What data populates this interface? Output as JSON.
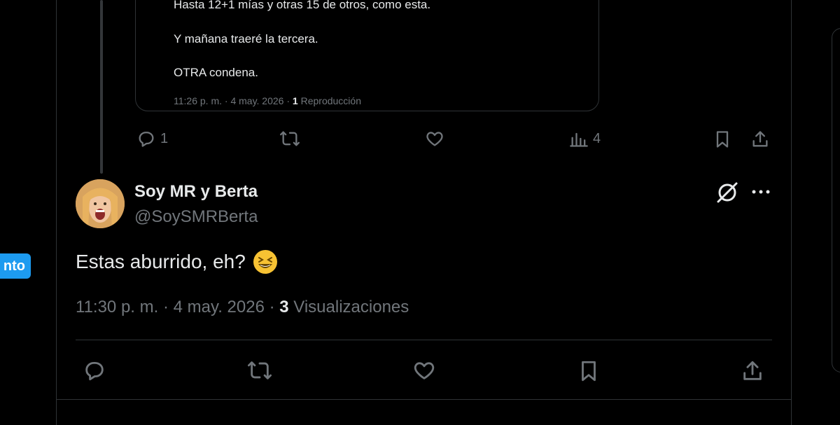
{
  "left_panel": {
    "button_label": "nto"
  },
  "quoted_post": {
    "lines": [
      "Hasta 12+1 mías y otras 15 de otros, como esta.",
      "Y mañana traeré la tercera.",
      "OTRA condena."
    ],
    "time": "11:26 p. m. · 4 may. 2026 · ",
    "plays_count": "1",
    "plays_label": " Reproducción"
  },
  "parent_actions": {
    "reply_count": "1",
    "views_count": "4",
    "icons": [
      "reply-icon",
      "retweet-icon",
      "like-icon",
      "views-icon",
      "bookmark-icon",
      "share-icon"
    ]
  },
  "tweet": {
    "display_name": "Soy MR y Berta",
    "handle": "@SoySMRBerta",
    "text": "Estas aburrido, eh?",
    "time": "11:30 p. m. · 4 may. 2026 · ",
    "views_count": "3",
    "views_label": " Visualizaciones"
  },
  "colors": {
    "accent": "#1d9bf0",
    "background": "#000000",
    "border": "#2f3336",
    "muted": "#71767b",
    "text": "#e7e9ea"
  }
}
